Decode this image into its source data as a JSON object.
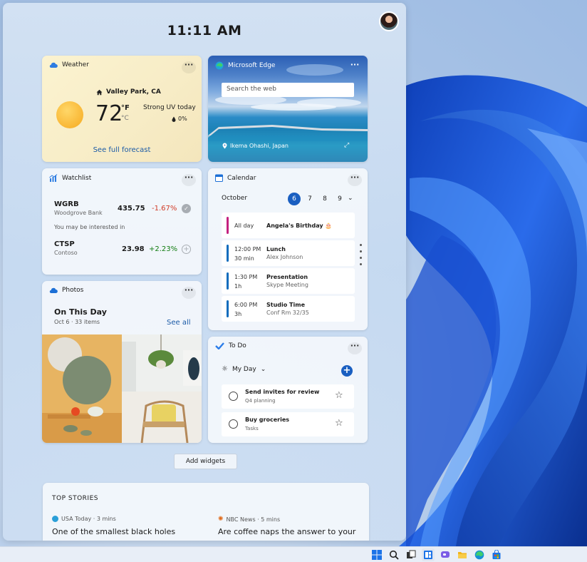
{
  "clock": {
    "time": "11:11 AM"
  },
  "weather": {
    "title": "Weather",
    "location": "Valley Park, CA",
    "temperature": "72",
    "unit_f": "°F",
    "unit_c": "°C",
    "condition": "Strong UV today",
    "precip": "0%",
    "link": "See full forecast"
  },
  "edge": {
    "title": "Microsoft Edge",
    "search_placeholder": "Search the web",
    "photo_location": "Ikema Ohashi, Japan"
  },
  "watchlist": {
    "title": "Watchlist",
    "stocks": [
      {
        "symbol": "WGRB",
        "name": "Woodgrove Bank",
        "price": "435.75",
        "change": "-1.67%",
        "change_color": "#d13b27"
      },
      {
        "symbol": "CTSP",
        "name": "Contoso",
        "price": "23.98",
        "change": "+2.23%",
        "change_color": "#107c10"
      }
    ],
    "interested_label": "You may be interested in"
  },
  "photos": {
    "title": "Photos",
    "heading": "On This Day",
    "subheading": "Oct 6 · 33 items",
    "link": "See all"
  },
  "calendar": {
    "title": "Calendar",
    "month": "October",
    "days": [
      "6",
      "7",
      "8",
      "9"
    ],
    "selected_day": "6",
    "events": [
      {
        "time": "All day",
        "duration": "",
        "title": "Angela's Birthday 🎂",
        "detail": "",
        "color": "#c4217f"
      },
      {
        "time": "12:00 PM",
        "duration": "30 min",
        "title": "Lunch",
        "detail": "Alex Johnson",
        "color": "#0f6cbd"
      },
      {
        "time": "1:30 PM",
        "duration": "1h",
        "title": "Presentation",
        "detail": "Skype Meeting",
        "color": "#0f6cbd"
      },
      {
        "time": "6:00 PM",
        "duration": "3h",
        "title": "Studio Time",
        "detail": "Conf Rm 32/35",
        "color": "#0f6cbd"
      }
    ]
  },
  "todo": {
    "title": "To Do",
    "list": "My Day",
    "tasks": [
      {
        "title": "Send invites for review",
        "subtitle": "Q4 planning"
      },
      {
        "title": "Buy groceries",
        "subtitle": "Tasks"
      }
    ]
  },
  "add_widgets": {
    "label": "Add widgets"
  },
  "top_stories": {
    "title": "TOP STORIES",
    "stories": [
      {
        "source": "USA Today · 3 mins",
        "headline": "One of the smallest black holes"
      },
      {
        "source": "NBC News · 5 mins",
        "headline": "Are coffee naps the answer to your"
      }
    ]
  },
  "taskbar": {
    "icons": [
      "start-icon",
      "search-icon",
      "task-view-icon",
      "widgets-icon",
      "chat-icon",
      "file-explorer-icon",
      "edge-icon",
      "store-icon"
    ]
  }
}
